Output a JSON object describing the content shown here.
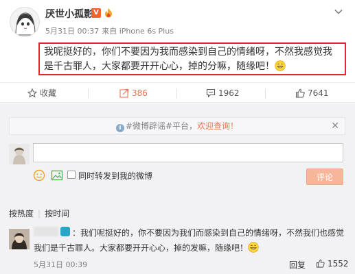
{
  "post": {
    "username": "厌世小孤影",
    "vip_badge": "V",
    "timestamp": "5月31日 00:37",
    "source": "来自 iPhone 6s Plus",
    "content": "我呢挺好的，你们不要因为我而感染到自己的情绪呀，不然我感觉我是千古罪人，大家都要开开心心，掉的分嘛，随缘吧！"
  },
  "actions": {
    "favorite": "收藏",
    "repost": "386",
    "comment": "1962",
    "like": "7641"
  },
  "notice": {
    "prefix": "#微博辟谣#平台，",
    "link": "欢迎查询！"
  },
  "composer": {
    "input_value": "",
    "repost_label": "同时转发到我的微博",
    "submit_label": "评论"
  },
  "sort": {
    "by_hot": "按热度",
    "by_time": "按时间"
  },
  "top_comment": {
    "text": "：我们呢挺好的，你不要因为我们而感染到自己的情绪呀，不然我们也感觉我们是千古罪人。大家都要开开心心，掉的发嘛，随缘吧！",
    "timestamp": "5月31日 00:39",
    "reply_label": "回复",
    "likes": "1552"
  },
  "colors": {
    "highlight_border": "#e3262b",
    "accent": "#eb7350",
    "submit_disabled": "#f7b69a"
  }
}
